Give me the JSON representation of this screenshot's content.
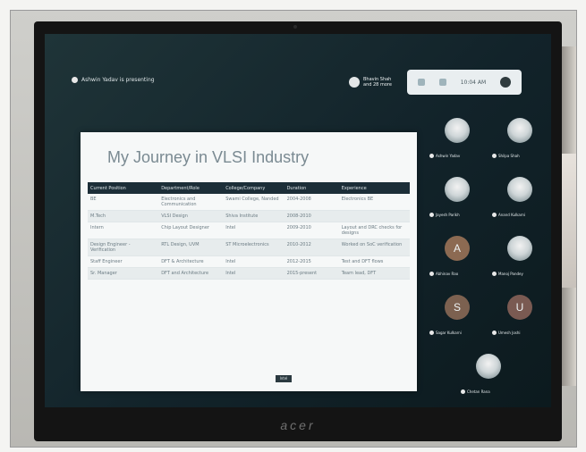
{
  "call": {
    "presenting_text": "Ashwin Yadav is presenting",
    "host_line_1": "Bhavin Shah",
    "host_line_2": "and 28 more",
    "status_time": "10:04 AM"
  },
  "slide": {
    "title": "My Journey in VLSI Industry",
    "columns": [
      "Current Position",
      "Department/Role",
      "College/Company",
      "Duration",
      "Experience"
    ],
    "rows": [
      [
        "BE",
        "Electronics and Communication",
        "Swami College, Nanded",
        "2004-2008",
        "Electronics BE"
      ],
      [
        "M.Tech",
        "VLSI Design",
        "Shiva Institute",
        "2008-2010",
        ""
      ],
      [
        "Intern",
        "Chip Layout Designer",
        "Intel",
        "2009-2010",
        "Layout and DRC checks for designs"
      ],
      [
        "Design Engineer - Verification",
        "RTL Design, UVM",
        "ST Microelectronics",
        "2010-2012",
        "Worked on SoC verification"
      ],
      [
        "Staff Engineer",
        "DFT & Architecture",
        "Intel",
        "2012-2015",
        "Test and DFT flows"
      ],
      [
        "Sr. Manager",
        "DFT and Architecture",
        "Intel",
        "2015-present",
        "Team lead, DFT"
      ]
    ],
    "footer_tag": "Intel"
  },
  "participants": [
    {
      "name": "Ashwin Yadav",
      "avatar_type": "photo",
      "color": "#6e8a8f"
    },
    {
      "name": "Shilpa Shah",
      "avatar_type": "photo",
      "color": "#8a9ea2"
    },
    {
      "name": "Jayesh Parikh",
      "avatar_type": "photo",
      "color": "#7c8f93"
    },
    {
      "name": "Anand Kulkarni",
      "avatar_type": "photo",
      "color": "#5f7479"
    },
    {
      "name": "Abhinav Rao",
      "avatar_type": "letter",
      "letter": "A",
      "color": "#8c6a52"
    },
    {
      "name": "Manoj Pandey",
      "avatar_type": "photo",
      "color": "#6b7f84"
    },
    {
      "name": "Sagar Kulkarni",
      "avatar_type": "letter",
      "letter": "S",
      "color": "#7c6150"
    },
    {
      "name": "Umesh Joshi",
      "avatar_type": "letter",
      "letter": "U",
      "color": "#7a5a52"
    },
    {
      "name": "Chetan Rana",
      "avatar_type": "photo",
      "color": "#9aa7a9"
    }
  ],
  "monitor": {
    "brand": "acer"
  }
}
